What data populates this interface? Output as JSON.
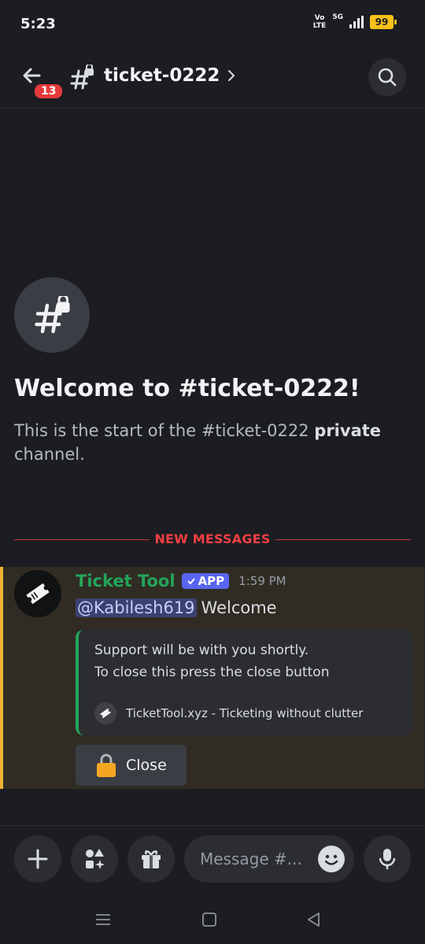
{
  "status_bar": {
    "time": "5:23",
    "volte_top": "Vo",
    "volte_bottom": "LTE",
    "network": "5G",
    "battery": "99"
  },
  "header": {
    "notification_count": "13",
    "channel_name": "ticket-0222"
  },
  "welcome": {
    "title": "Welcome to #ticket-0222!",
    "desc_prefix": "This is the start of the #ticket-0222 ",
    "desc_bold": "private",
    "desc_suffix": " channel."
  },
  "divider": {
    "label": "NEW MESSAGES"
  },
  "message": {
    "author": "Ticket Tool",
    "tag": "APP",
    "time": "1:59 PM",
    "mention": "@Kabilesh619",
    "text": "Welcome",
    "embed": {
      "line1": "Support will be with you shortly.",
      "line2": "To close this press the close button",
      "footer": "TicketTool.xyz - Ticketing without clutter"
    },
    "button_label": "Close"
  },
  "composer": {
    "placeholder": "Message #..."
  },
  "colors": {
    "background": "#1c1d22",
    "accent_green": "#23a55a",
    "accent_red": "#f23f43",
    "highlight_yellow": "#f0b232",
    "app_tag": "#5865f2"
  },
  "icons": [
    "back-arrow-icon",
    "hash-lock-icon",
    "chevron-right-icon",
    "search-icon",
    "ticket-icon",
    "lock-icon",
    "plus-icon",
    "apps-icon",
    "gift-icon",
    "emoji-icon",
    "microphone-icon",
    "nav-menu-icon",
    "nav-home-icon",
    "nav-back-icon"
  ]
}
